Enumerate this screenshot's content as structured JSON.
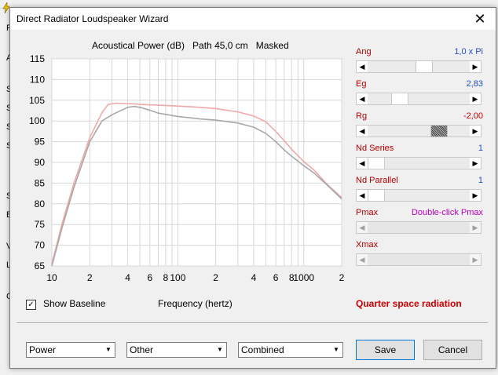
{
  "background": {
    "menu_letter": "Fi",
    "side_letters": [
      "A",
      "S",
      "S",
      "S",
      "S",
      "S",
      "B",
      "V",
      "L",
      "C"
    ]
  },
  "window": {
    "title": "Direct Radiator Loudspeaker Wizard",
    "close_glyph": "✕"
  },
  "chart": {
    "header": "Acoustical Power (dB)   Path 45,0 cm   Masked",
    "xlabel": "Frequency (hertz)"
  },
  "chart_data": {
    "type": "line",
    "title": "Acoustical Power (dB)   Path 45,0 cm   Masked",
    "xlabel": "Frequency (hertz)",
    "ylabel": "",
    "xscale": "log",
    "xlim": [
      10,
      2000
    ],
    "ylim": [
      65,
      115
    ],
    "yticks": [
      65,
      70,
      75,
      80,
      85,
      90,
      95,
      100,
      105,
      110,
      115
    ],
    "xtick_labels": [
      {
        "f": 10,
        "label": "10"
      },
      {
        "f": 20,
        "label": "2"
      },
      {
        "f": 40,
        "label": "4"
      },
      {
        "f": 60,
        "label": "6"
      },
      {
        "f": 80,
        "label": "8"
      },
      {
        "f": 100,
        "label": "100"
      },
      {
        "f": 200,
        "label": "2"
      },
      {
        "f": 400,
        "label": "4"
      },
      {
        "f": 600,
        "label": "6"
      },
      {
        "f": 800,
        "label": "8"
      },
      {
        "f": 1000,
        "label": "1000"
      },
      {
        "f": 2000,
        "label": "2"
      }
    ],
    "grid": true,
    "series": [
      {
        "color": "#f0a8a8",
        "x": [
          10,
          12,
          15,
          20,
          25,
          28,
          32,
          40,
          50,
          70,
          100,
          150,
          200,
          300,
          400,
          500,
          600,
          700,
          800,
          1000,
          1200,
          1500,
          2000
        ],
        "y": [
          65.5,
          75,
          85,
          96,
          102,
          104,
          104.3,
          104.2,
          104,
          103.8,
          103.6,
          103.3,
          103,
          102.2,
          101.2,
          99.8,
          97.5,
          95.2,
          93.2,
          90.2,
          88.2,
          85,
          81.5
        ]
      },
      {
        "color": "#a8a8a8",
        "x": [
          10,
          12,
          15,
          20,
          25,
          30,
          40,
          45,
          50,
          60,
          70,
          100,
          150,
          200,
          300,
          400,
          500,
          600,
          700,
          800,
          1000,
          1200,
          1500,
          2000
        ],
        "y": [
          65,
          74,
          84,
          95,
          100,
          101.5,
          103.3,
          103.5,
          103.3,
          102.6,
          101.9,
          101.1,
          100.5,
          100.2,
          99.5,
          98.5,
          97,
          95,
          93,
          91.5,
          89.2,
          87.5,
          84.8,
          81.2
        ]
      }
    ]
  },
  "controls": {
    "ang": {
      "label": "Ang",
      "value": "1,0 x Pi",
      "position": 0.55
    },
    "eg": {
      "label": "Eg",
      "value": "2,83",
      "position": 0.27
    },
    "rg": {
      "label": "Rg",
      "value": "-2,00",
      "position": 0.73
    },
    "nd_series": {
      "label": "Nd  Series",
      "value": "1",
      "position": 0.0
    },
    "nd_parallel": {
      "label": "Nd  Parallel",
      "value": "1",
      "position": 0.0
    },
    "pmax": {
      "label": "Pmax",
      "value": "Double-click Pmax"
    },
    "xmax": {
      "label": "Xmax",
      "value": ""
    }
  },
  "show_baseline": {
    "label": "Show Baseline",
    "checked": true,
    "check_glyph": "✓"
  },
  "radiation": "Quarter space radiation",
  "combos": [
    {
      "id": "power",
      "value": "Power"
    },
    {
      "id": "other",
      "value": "Other"
    },
    {
      "id": "combined",
      "value": "Combined"
    }
  ],
  "buttons": {
    "save": "Save",
    "cancel": "Cancel"
  },
  "colors": {
    "label_red": "#b00000",
    "value_blue": "#1f4fbf",
    "pmax_magenta": "#c000c0",
    "curve_pink": "#f0a8a8",
    "curve_gray": "#a8a8a8",
    "radiation_red": "#cc0000"
  }
}
